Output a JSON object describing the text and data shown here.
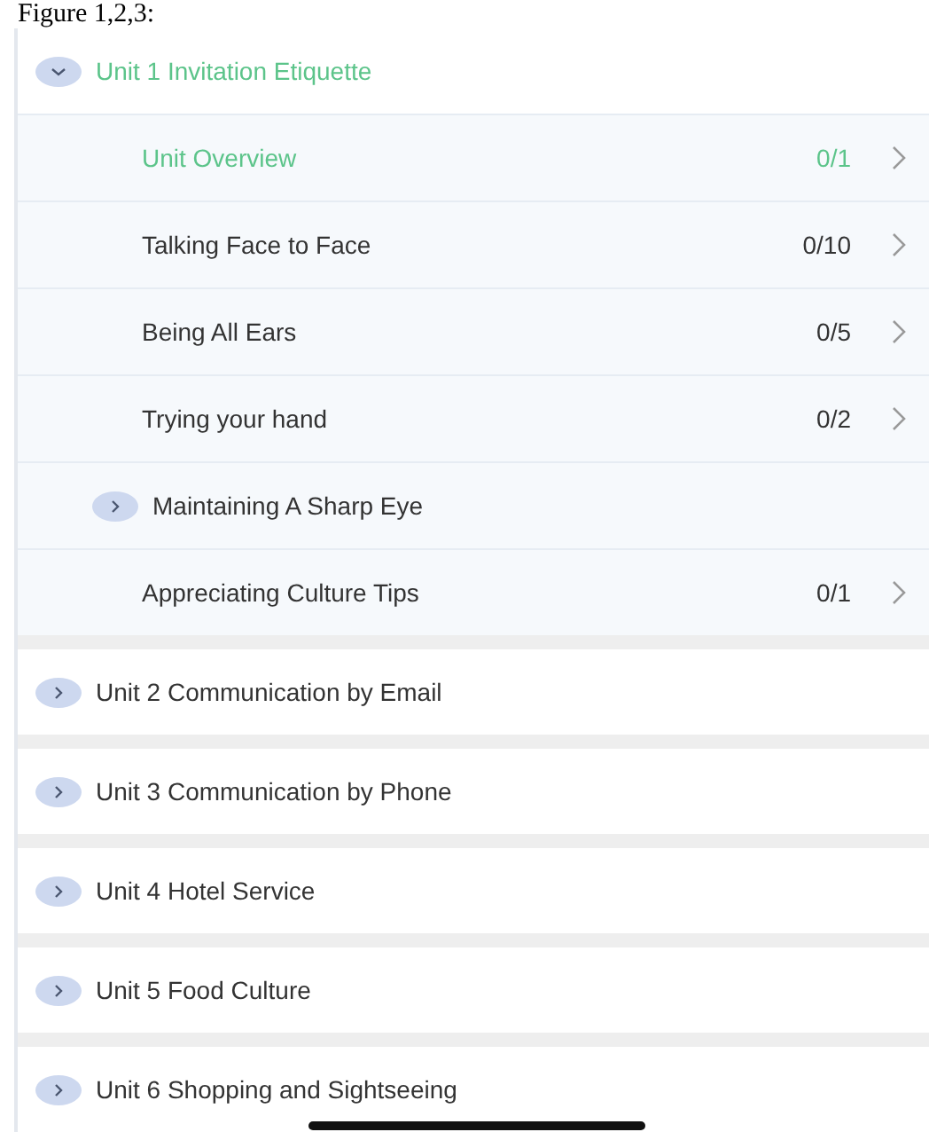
{
  "caption": "Figure 1,2,3:",
  "units": [
    {
      "title": "Unit 1 Invitation Etiquette",
      "expanded": true,
      "selected": true,
      "children": [
        {
          "kind": "lesson",
          "title": "Unit Overview",
          "progress": "0/1",
          "selected": true
        },
        {
          "kind": "lesson",
          "title": "Talking Face to Face",
          "progress": "0/10",
          "selected": false
        },
        {
          "kind": "lesson",
          "title": "Being All Ears",
          "progress": "0/5",
          "selected": false
        },
        {
          "kind": "lesson",
          "title": "Trying your hand",
          "progress": "0/2",
          "selected": false
        },
        {
          "kind": "group",
          "title": "Maintaining A Sharp Eye",
          "expanded": false,
          "selected": false
        },
        {
          "kind": "lesson",
          "title": "Appreciating Culture Tips",
          "progress": "0/1",
          "selected": false
        }
      ]
    },
    {
      "title": "Unit 2 Communication by Email",
      "expanded": false,
      "selected": false
    },
    {
      "title": "Unit 3 Communication by Phone",
      "expanded": false,
      "selected": false
    },
    {
      "title": "Unit 4 Hotel Service",
      "expanded": false,
      "selected": false
    },
    {
      "title": "Unit 5 Food Culture",
      "expanded": false,
      "selected": false
    },
    {
      "title": "Unit 6 Shopping and Sightseeing",
      "expanded": false,
      "selected": false
    }
  ]
}
